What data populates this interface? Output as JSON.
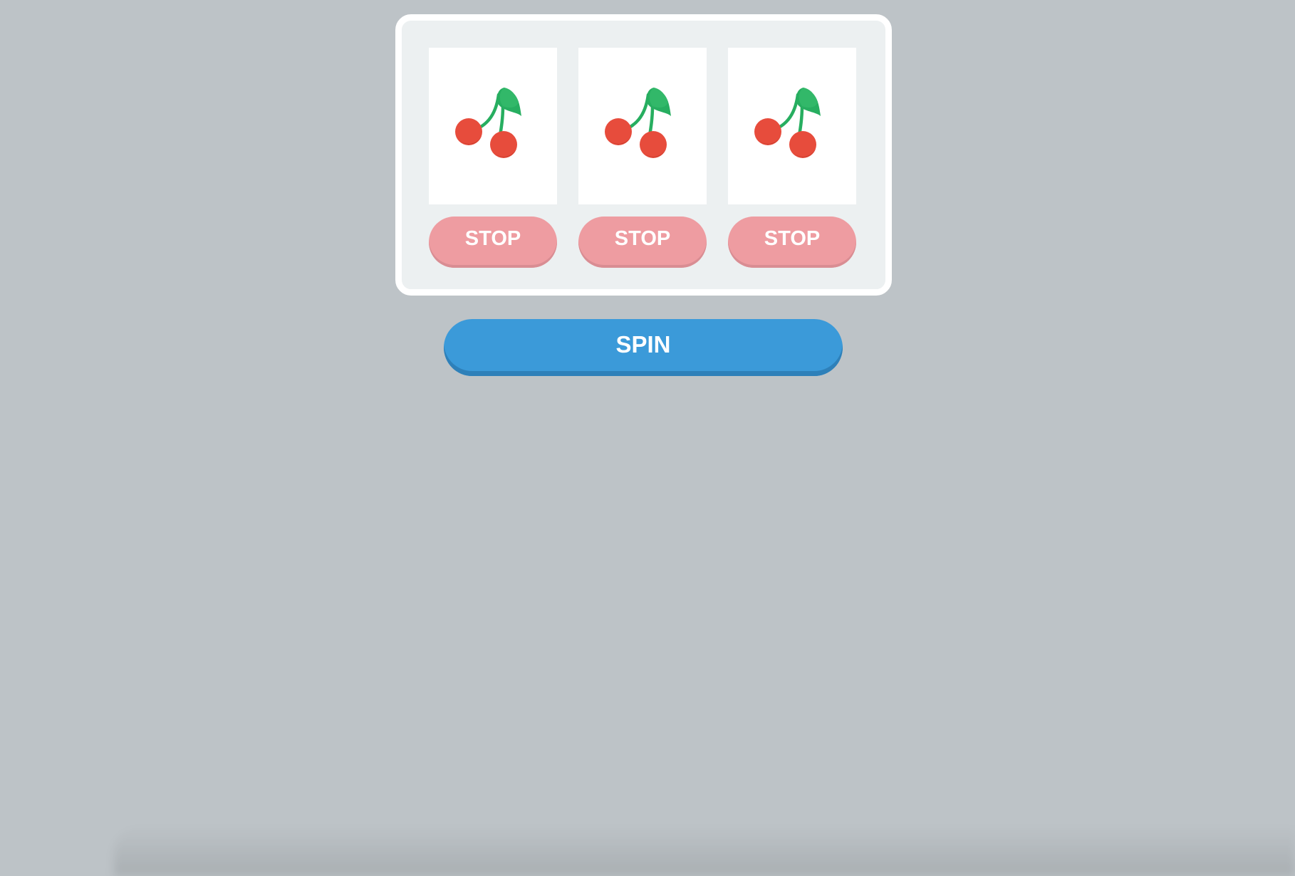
{
  "reels": [
    {
      "symbol": "cherry-icon",
      "stop_label": "STOP"
    },
    {
      "symbol": "cherry-icon",
      "stop_label": "STOP"
    },
    {
      "symbol": "cherry-icon",
      "stop_label": "STOP"
    }
  ],
  "spin_label": "SPIN",
  "colors": {
    "background": "#bdc3c7",
    "machine_panel": "#ecf0f1",
    "machine_border": "#ffffff",
    "stop_button": "#ee9ca1",
    "spin_button": "#3b9ad9",
    "cherry_red": "#e74c3c",
    "stem_green": "#27ae60"
  }
}
